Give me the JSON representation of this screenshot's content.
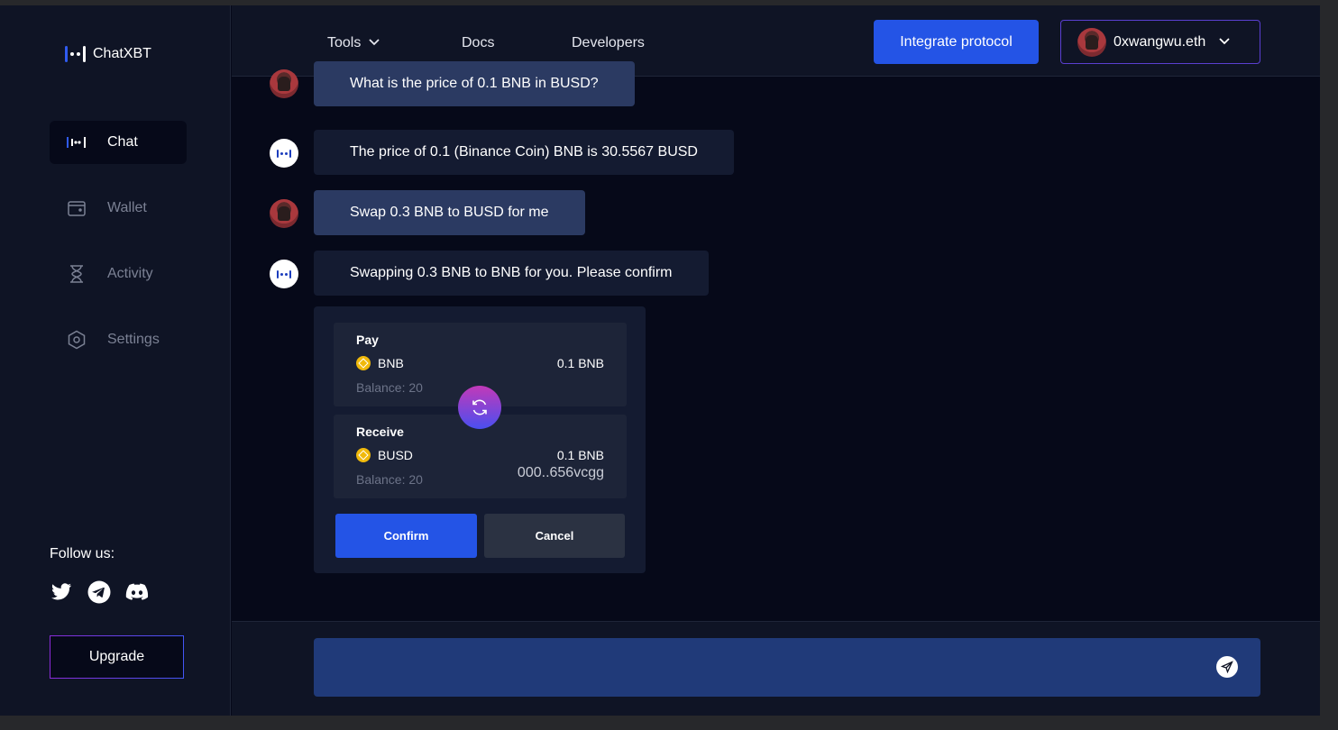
{
  "brand": {
    "name": "ChatXBT"
  },
  "sidebar": {
    "items": [
      {
        "label": "Chat",
        "icon": "chat-logo-icon",
        "active": true
      },
      {
        "label": "Wallet",
        "icon": "wallet-icon",
        "active": false
      },
      {
        "label": "Activity",
        "icon": "hourglass-icon",
        "active": false
      },
      {
        "label": "Settings",
        "icon": "settings-hexagon-icon",
        "active": false
      }
    ],
    "follow_label": "Follow us:",
    "socials": [
      "twitter-icon",
      "telegram-icon",
      "discord-icon"
    ],
    "upgrade_label": "Upgrade"
  },
  "header": {
    "menu": [
      {
        "label": "Tools",
        "has_dropdown": true
      },
      {
        "label": "Docs",
        "has_dropdown": false
      },
      {
        "label": "Developers",
        "has_dropdown": false
      }
    ],
    "integrate_label": "Integrate protocol",
    "account_name": "0xwangwu.eth"
  },
  "messages": [
    {
      "role": "user",
      "text": "What is the price of 0.1 BNB in BUSD?"
    },
    {
      "role": "bot",
      "text": "The price of 0.1 (Binance Coin) BNB is 30.5567 BUSD"
    },
    {
      "role": "user",
      "text": "Swap 0.3 BNB to BUSD for me"
    },
    {
      "role": "bot",
      "text": "Swapping 0.3 BNB to BNB for you. Please confirm"
    }
  ],
  "swap": {
    "pay": {
      "title": "Pay",
      "token": "BNB",
      "amount": "0.1 BNB",
      "balance": "Balance: 20"
    },
    "receive": {
      "title": "Receive",
      "token": "BUSD",
      "amount": "0.1 BNB",
      "address": "000..656vcgg",
      "balance": "Balance: 20"
    },
    "confirm_label": "Confirm",
    "cancel_label": "Cancel"
  },
  "composer": {
    "placeholder": "",
    "value": ""
  },
  "colors": {
    "accent": "#2454e6",
    "background": "#060919",
    "panel": "#0f1425",
    "user_bubble": "#2b3a62",
    "bot_bubble": "#141b31",
    "coin": "#f0b90b"
  }
}
